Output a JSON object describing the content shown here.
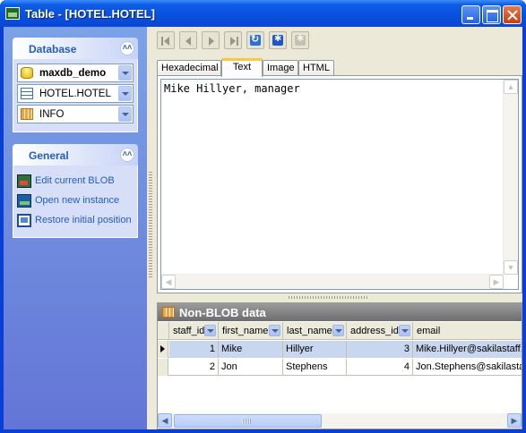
{
  "window": {
    "title": "Table - [HOTEL.HOTEL]"
  },
  "sidebar": {
    "database_group": {
      "title": "Database",
      "collapse_glyph": "˄˄",
      "database": "maxdb_demo",
      "table": "HOTEL.HOTEL",
      "info": "INFO"
    },
    "general_group": {
      "title": "General",
      "collapse_glyph": "˄˄",
      "links": [
        {
          "label": "Edit current BLOB",
          "icon": "edit-blob-icon"
        },
        {
          "label": "Open new instance",
          "icon": "new-instance-icon"
        },
        {
          "label": "Restore initial position",
          "icon": "restore-position-icon"
        }
      ]
    }
  },
  "tabs": [
    {
      "label": "Hexadecimal",
      "active": false
    },
    {
      "label": "Text",
      "active": true
    },
    {
      "label": "Image",
      "active": false
    },
    {
      "label": "HTML",
      "active": false
    }
  ],
  "editor": {
    "content": "Mike Hillyer, manager"
  },
  "grid": {
    "title": "Non-BLOB data",
    "columns": [
      "staff_id",
      "first_name",
      "last_name",
      "address_id",
      "email"
    ],
    "rows": [
      {
        "staff_id": "1",
        "first_name": "Mike",
        "last_name": "Hillyer",
        "address_id": "3",
        "email": "Mike.Hillyer@sakilastaff.com",
        "selected": true
      },
      {
        "staff_id": "2",
        "first_name": "Jon",
        "last_name": "Stephens",
        "address_id": "4",
        "email": "Jon.Stephens@sakilastaff.com",
        "selected": false
      }
    ],
    "scroll_glyph": "|||"
  },
  "colors": {
    "titlebar": "#0a4fdc",
    "sidebar": "#6f8ee0",
    "accent_link": "#215dc6",
    "active_tab_top": "#ffc83c",
    "selected_row": "#c9d6ef"
  }
}
